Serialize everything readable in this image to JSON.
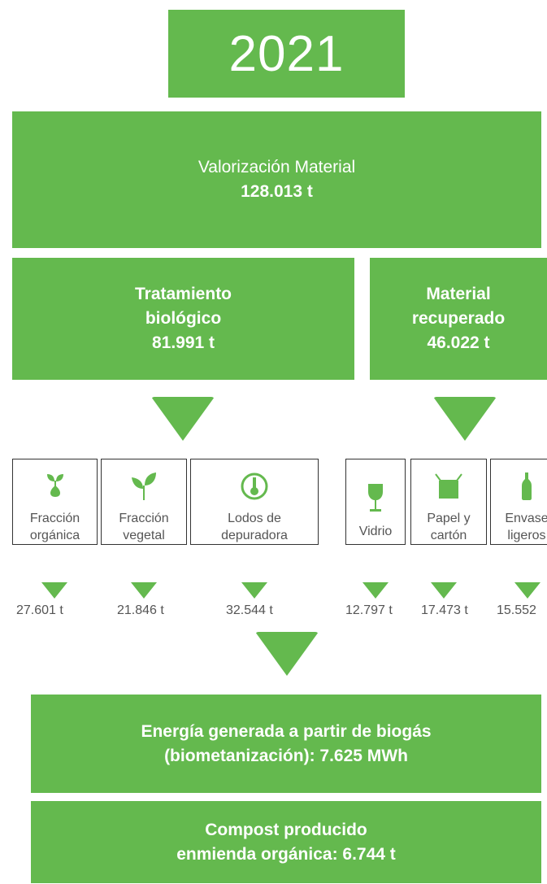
{
  "year": "2021",
  "main": {
    "title": "Valorización Material",
    "value": "128.013 t"
  },
  "left_branch": {
    "title_l1": "Tratamiento",
    "title_l2": "biológico",
    "value": "81.991 t"
  },
  "right_branch": {
    "title_l1": "Material",
    "title_l2": "recuperado",
    "value": "46.022 t"
  },
  "items": [
    {
      "icon": "sprout-icon",
      "label": "Fracción\norgánica",
      "value": "27.601 t"
    },
    {
      "icon": "leaf-icon",
      "label": "Fracción\nvegetal",
      "value": "21.846 t"
    },
    {
      "icon": "thermometer-icon",
      "label": "Lodos de\ndepuradora",
      "value": "32.544 t"
    },
    {
      "icon": "wine-glass-icon",
      "label": "Vidrio",
      "value": "12.797 t"
    },
    {
      "icon": "paper-box-icon",
      "label": "Papel y\ncartón",
      "value": "17.473 t"
    },
    {
      "icon": "bottle-icon",
      "label": "Envase\nligeros",
      "value": "15.552"
    }
  ],
  "outputs": [
    {
      "line1": "Energía generada a partir de biogás",
      "line2": "(biometanización): 7.625 MWh"
    },
    {
      "line1": "Compost producido",
      "line2": "enmienda orgánica: 6.744 t"
    }
  ],
  "colors": {
    "green": "#64b94e",
    "border": "#333333",
    "text": "#555555"
  }
}
